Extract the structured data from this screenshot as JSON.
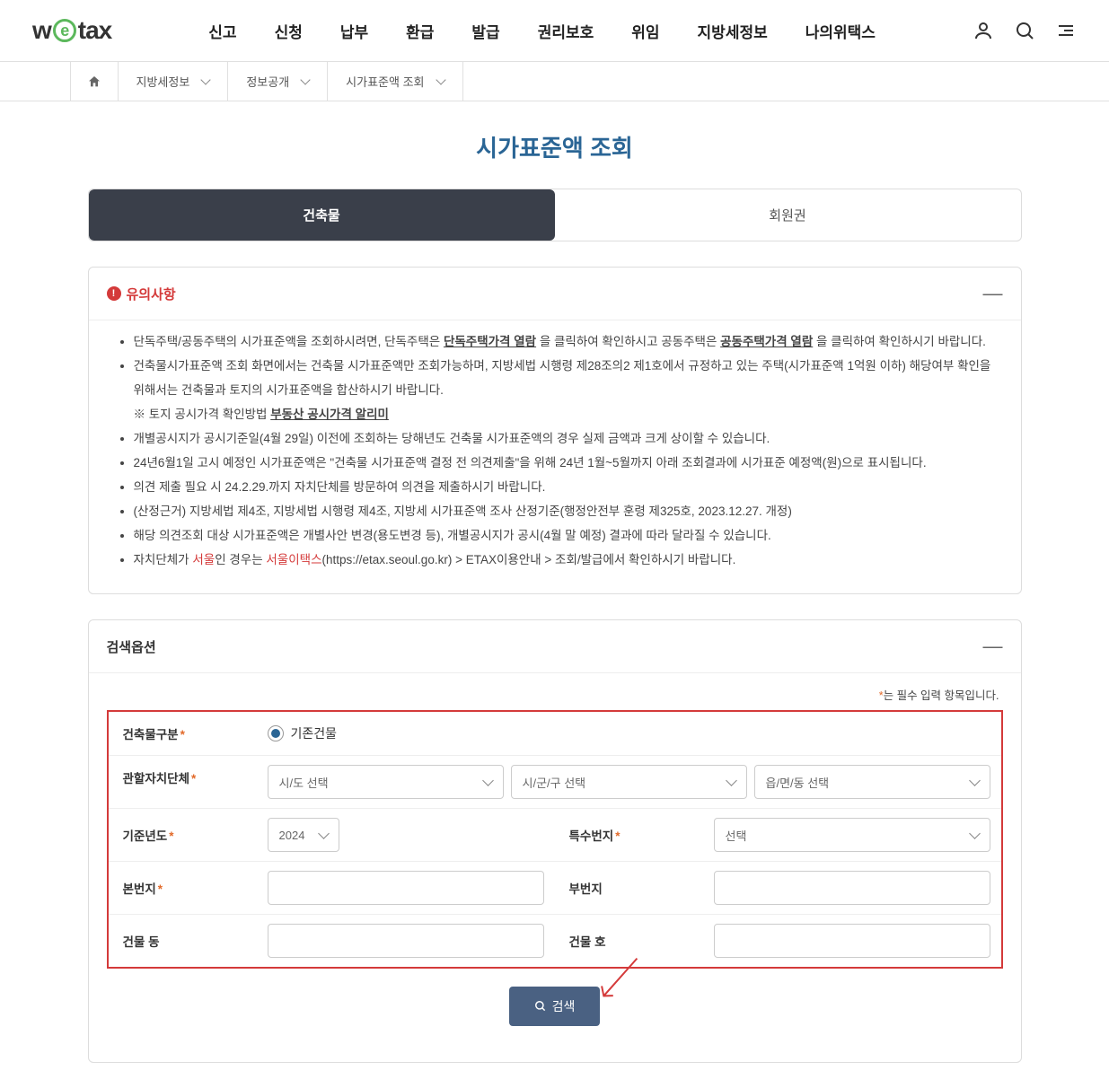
{
  "header": {
    "logo_pre": "w",
    "logo_e": "e",
    "logo_post": "tax",
    "nav": [
      "신고",
      "신청",
      "납부",
      "환급",
      "발급",
      "권리보호",
      "위임",
      "지방세정보",
      "나의위택스"
    ],
    "my_label": "MY"
  },
  "breadcrumb": {
    "items": [
      "지방세정보",
      "정보공개",
      "시가표준액 조회"
    ]
  },
  "page_title": "시가표준액 조회",
  "tabs": {
    "building": "건축물",
    "membership": "회원권"
  },
  "notice": {
    "title": "유의사항",
    "items": [
      {
        "pre": "단독주택/공동주택의 시가표준액을 조회하시려면, 단독주택은 ",
        "link1": "단독주택가격 열람",
        "mid": " 을 클릭하여 확인하시고 공동주택은 ",
        "link2": "공동주택가격 열람",
        "post": " 을 클릭하여 확인하시기 바랍니다."
      },
      {
        "text": "건축물시가표준액 조회 화면에서는 건축물 시가표준액만 조회가능하며, 지방세법 시행령 제28조의2 제1호에서 규정하고 있는 주택(시가표준액 1억원 이하) 해당여부 확인을 위해서는 건축물과 토지의 시가표준액을 합산하시기 바랍니다."
      },
      {
        "sub_pre": "※ 토지 공시가격 확인방법 ",
        "sub_link": "부동산 공시가격 알리미"
      },
      {
        "text": "개별공시지가 공시기준일(4월 29일) 이전에 조회하는 당해년도 건축물 시가표준액의 경우 실제 금액과 크게 상이할 수 있습니다."
      },
      {
        "text": "24년6월1일 고시 예정인 시가표준액은 \"건축물 시가표준액 결정 전 의견제출\"을 위해 24년 1월~5월까지 아래 조회결과에 시가표준 예정액(원)으로 표시됩니다."
      },
      {
        "text": "의견 제출 필요 시 24.2.29.까지 자치단체를 방문하여 의견을 제출하시기 바랍니다."
      },
      {
        "text": "(산정근거) 지방세법 제4조, 지방세법 시행령 제4조, 지방세 시가표준액 조사 산정기준(행정안전부 훈령 제325호, 2023.12.27. 개정)"
      },
      {
        "text": "해당 의견조회 대상 시가표준액은 개별사안 변경(용도변경 등), 개별공시지가 공시(4월 말 예정) 결과에 따라 달라질 수 있습니다."
      },
      {
        "pre2": "자치단체가 ",
        "red1": "서울",
        "mid2": "인 경우는 ",
        "red2": "서울이택스",
        "post2": "(https://etax.seoul.go.kr) > ETAX이용안내 > 조회/발급에서 확인하시기 바랍니다."
      }
    ]
  },
  "search": {
    "title": "검색옵션",
    "required_note_ast": "*",
    "required_note": "는 필수 입력 항목입니다.",
    "labels": {
      "building_type": "건축물구분",
      "authority": "관할자치단체",
      "year": "기준년도",
      "special_no": "특수번지",
      "main_no": "본번지",
      "sub_no": "부번지",
      "building_dong": "건물 동",
      "building_ho": "건물 호"
    },
    "existing_building": "기존건물",
    "sido_placeholder": "시/도 선택",
    "sigungu_placeholder": "시/군/구 선택",
    "eupmyeondong_placeholder": "읍/면/동 선택",
    "year_value": "2024",
    "special_placeholder": "선택",
    "button": "검색"
  }
}
